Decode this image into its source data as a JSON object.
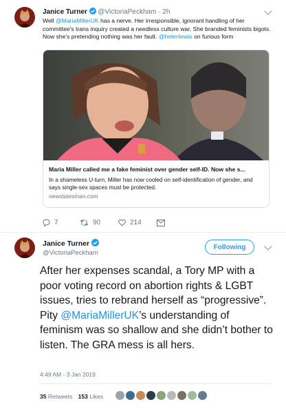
{
  "colors": {
    "link": "#1b95e0",
    "accent": "#1da1f2",
    "muted": "#657786",
    "verified": "#1da1f2"
  },
  "quoted": {
    "author_name": "Janice Turner",
    "handle": "@VictoriaPeckham",
    "time": "· 2h",
    "text_parts": [
      {
        "text": "Well ",
        "link": false
      },
      {
        "text": "@MariaMillerUK",
        "link": true
      },
      {
        "text": " has a nerve. Her irresponsible, ignorant handling of her committee's trans inquiry created a needless culture war. She branded feminists bigots. Now she's pretending nothing was her fault. ",
        "link": false
      },
      {
        "text": "@helenlewis",
        "link": true
      },
      {
        "text": " on furious form",
        "link": false
      }
    ],
    "card": {
      "title": "Maria Miller called me a fake feminist over gender self-ID. Now she s...",
      "description": "In a shameless U-turn, Miller has now cooled on self-identification of gender, and says single-sex spaces must be protected.",
      "domain": "newstatesman.com"
    },
    "actions": {
      "replies": "7",
      "retweets": "90",
      "likes": "214"
    }
  },
  "main": {
    "author_name": "Janice Turner",
    "handle": "@VictoriaPeckham",
    "follow_label": "Following",
    "text_parts": [
      {
        "text": "After her expenses scandal, a Tory MP with a poor voting record on abortion rights & LGBT issues, tries to rebrand herself as “progressive”. Pity ",
        "link": false
      },
      {
        "text": "@MariaMillerUK",
        "link": true
      },
      {
        "text": "’s understanding of feminism was so shallow and she didn’t bother to listen. The GRA mess is all hers.",
        "link": false
      }
    ],
    "timestamp": "4:49 AM - 3 Jan 2019",
    "stats": {
      "retweets_count": "35",
      "retweets_label": "Retweets",
      "likes_count": "153",
      "likes_label": "Likes"
    },
    "likers": [
      "#9aa4ad",
      "#3b6e8f",
      "#c98b5a",
      "#2f3b45",
      "#8aa37a",
      "#b9b9b9",
      "#7a6f66",
      "#a7b8a0",
      "#5f7d94"
    ]
  }
}
